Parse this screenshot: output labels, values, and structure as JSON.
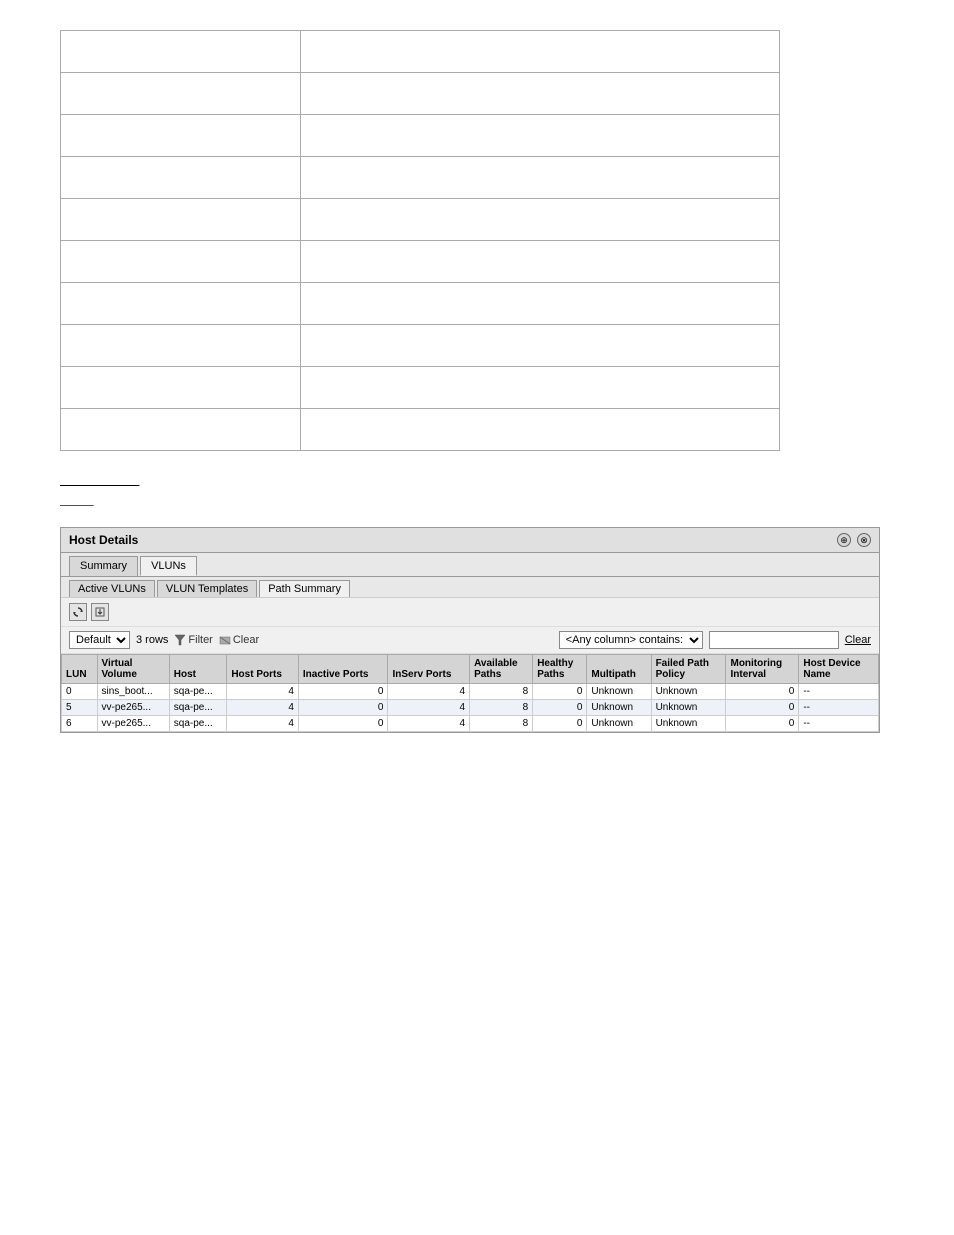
{
  "info_table": {
    "rows": [
      {
        "label": "",
        "value": ""
      },
      {
        "label": "",
        "value": ""
      },
      {
        "label": "",
        "value": ""
      },
      {
        "label": "",
        "value": ""
      },
      {
        "label": "",
        "value": ""
      },
      {
        "label": "",
        "value": ""
      },
      {
        "label": "",
        "value": ""
      },
      {
        "label": "",
        "value": ""
      },
      {
        "label": "",
        "value": ""
      },
      {
        "label": "",
        "value": ""
      }
    ]
  },
  "links": {
    "line1": "",
    "line2": ""
  },
  "panel": {
    "title": "Host Details",
    "icons": [
      "⊕",
      "⊗"
    ],
    "tabs": [
      "Summary",
      "VLUNs"
    ],
    "active_tab": "VLUNs",
    "subtabs": [
      "Active VLUNs",
      "VLUN Templates",
      "Path Summary"
    ],
    "active_subtab": "Path Summary",
    "toolbar_icons": [
      "refresh",
      "export"
    ],
    "filter": {
      "default_label": "Default",
      "rows_count": "3 rows",
      "filter_label": "Filter",
      "clear_label": "Clear",
      "column_select_label": "<Any column> contains:",
      "column_options": [
        "<Any column> contains:"
      ],
      "text_value": "",
      "clear_right_label": "Clear"
    },
    "table": {
      "columns": [
        "LUN",
        "Virtual Volume",
        "Host",
        "Host Ports",
        "Inactive Ports",
        "InServ Ports",
        "Available Paths",
        "Healthy Paths",
        "Multipath",
        "Failed Path Policy",
        "Monitoring Interval",
        "Host Device Name"
      ],
      "rows": [
        {
          "lun": "0",
          "virtual_volume": "sins_boot...",
          "host": "sqa-pe...",
          "host_ports": "4",
          "inactive_ports": "0",
          "inserv_ports": "4",
          "available_paths": "8",
          "healthy_paths": "0",
          "multipath": "Unknown",
          "failed_path_policy": "Unknown",
          "monitoring_interval": "0",
          "host_device_name": "--"
        },
        {
          "lun": "5",
          "virtual_volume": "vv-pe265...",
          "host": "sqa-pe...",
          "host_ports": "4",
          "inactive_ports": "0",
          "inserv_ports": "4",
          "available_paths": "8",
          "healthy_paths": "0",
          "multipath": "Unknown",
          "failed_path_policy": "Unknown",
          "monitoring_interval": "0",
          "host_device_name": "--"
        },
        {
          "lun": "6",
          "virtual_volume": "vv-pe265...",
          "host": "sqa-pe...",
          "host_ports": "4",
          "inactive_ports": "0",
          "inserv_ports": "4",
          "available_paths": "8",
          "healthy_paths": "0",
          "multipath": "Unknown",
          "failed_path_policy": "Unknown",
          "monitoring_interval": "0",
          "host_device_name": "--"
        }
      ]
    }
  }
}
